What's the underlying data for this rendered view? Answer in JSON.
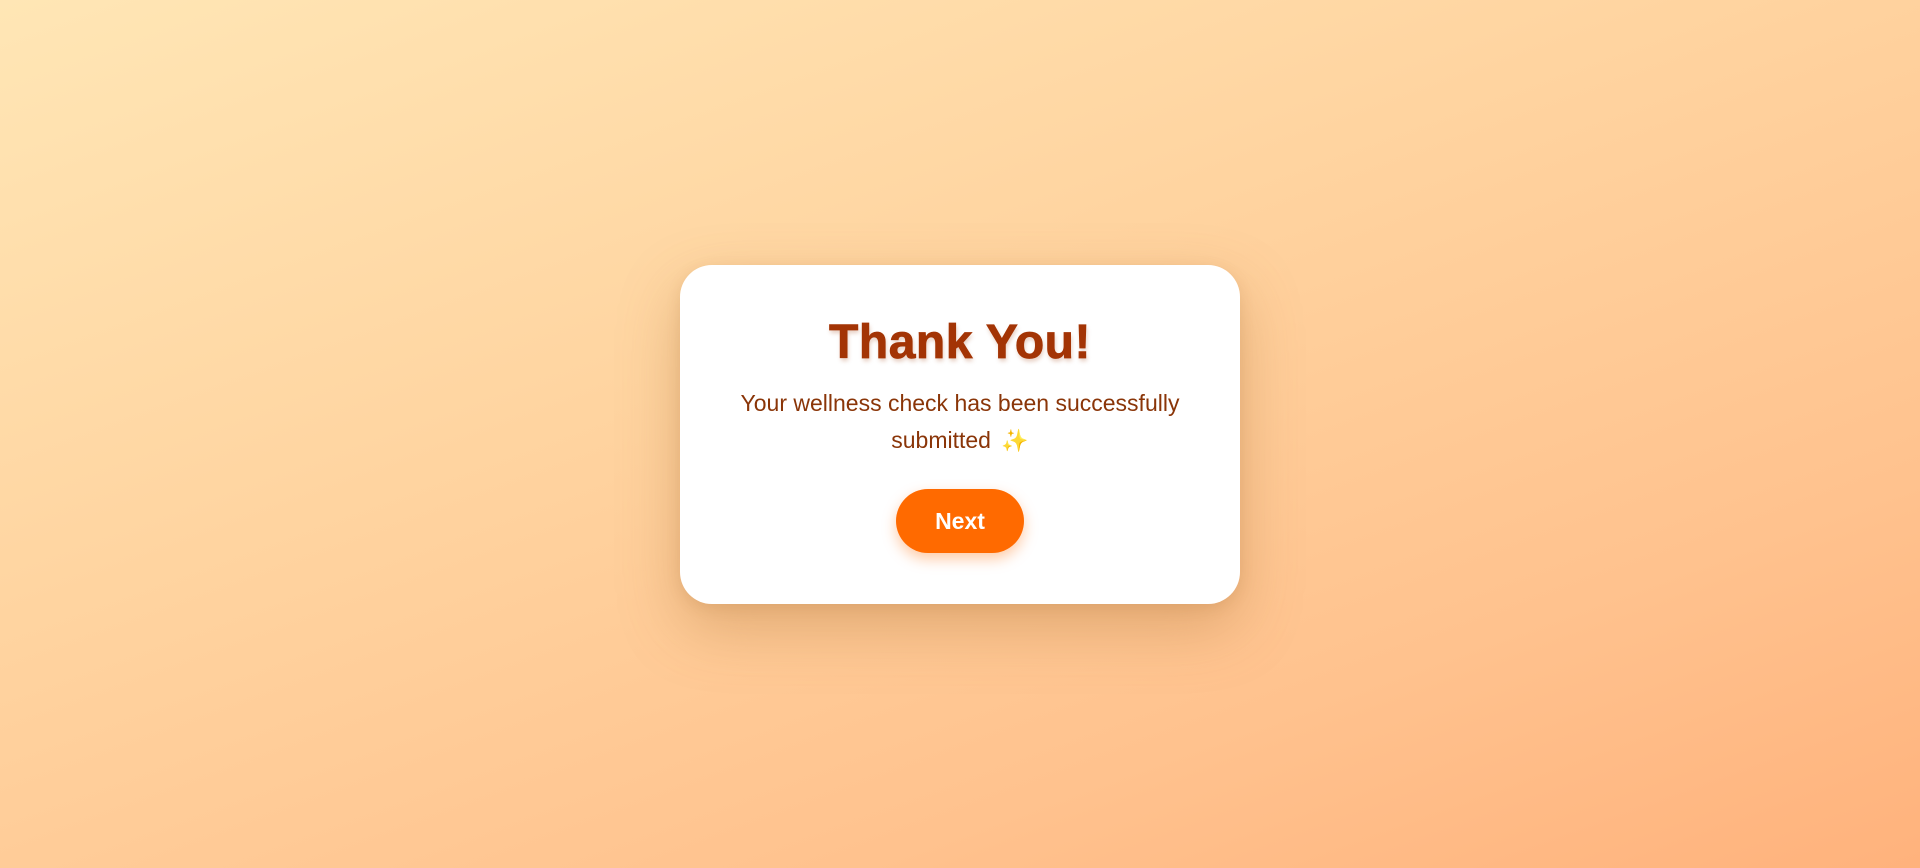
{
  "card": {
    "title": "Thank You!",
    "message": "Your wellness check has been successfully submitted",
    "sparkle": "✨",
    "next_label": "Next"
  },
  "colors": {
    "title": "#a33405",
    "message": "#8a3508",
    "button_bg": "#ff6a00",
    "button_text": "#ffffff",
    "card_bg": "#ffffff",
    "background_start": "#ffe6b5",
    "background_end": "#ffb27c"
  },
  "icons": {
    "sparkle": "sparkles-icon"
  }
}
